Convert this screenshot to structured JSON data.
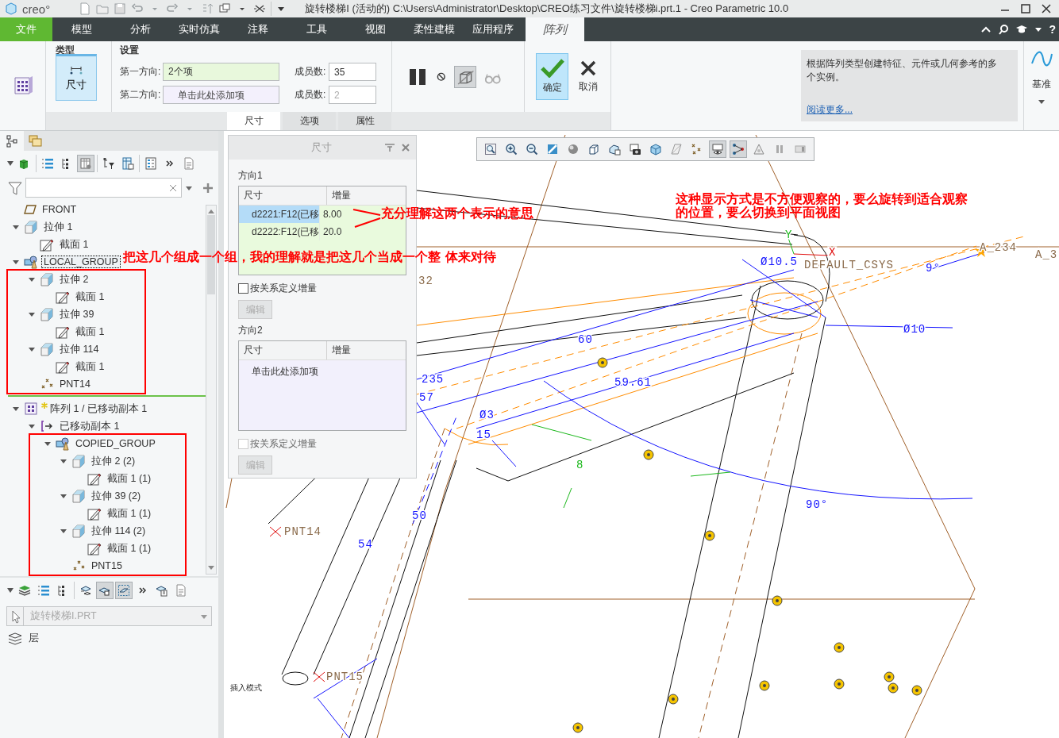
{
  "title_bar": {
    "logo": "creo°",
    "title": "旋转楼梯I (活动的) C:\\Users\\Administrator\\Desktop\\CREO练习文件\\旋转楼梯i.prt.1 - Creo Parametric 10.0"
  },
  "menu_tabs": [
    {
      "label": "文件",
      "kind": "file",
      "selected": false
    },
    {
      "label": "模型",
      "kind": "tab",
      "selected": false
    },
    {
      "label": "分析",
      "kind": "tab",
      "selected": false
    },
    {
      "label": "实时仿真",
      "kind": "tab",
      "selected": false
    },
    {
      "label": "注释",
      "kind": "tab",
      "selected": false
    },
    {
      "label": "工具",
      "kind": "tab",
      "selected": false
    },
    {
      "label": "视图",
      "kind": "tab",
      "selected": false
    },
    {
      "label": "柔性建模",
      "kind": "tab",
      "selected": false
    },
    {
      "label": "应用程序",
      "kind": "tab",
      "selected": false
    },
    {
      "label": "阵列",
      "kind": "tab",
      "selected": true
    }
  ],
  "menu_help": "?",
  "ribbon": {
    "type_group": {
      "title": "类型",
      "button": "尺寸"
    },
    "settings": {
      "title": "设置",
      "rows": [
        {
          "label": "第一方向:",
          "value": "2个项",
          "count_label": "成员数:",
          "count": "35",
          "count_disabled": false
        },
        {
          "label": "第二方向:",
          "placeholder": "单击此处添加项",
          "count_label": "成员数:",
          "count": "2",
          "count_disabled": true
        }
      ]
    },
    "tools": [
      {
        "kind": "pause",
        "pressed": false
      },
      {
        "kind": "prohibit",
        "pressed": false
      },
      {
        "kind": "preview",
        "pressed": true
      },
      {
        "kind": "glasses",
        "pressed": false
      }
    ],
    "confirm": "确定",
    "cancel": "取消",
    "info": {
      "text": "根据阵列类型创建特征、元件或几何参考的多个实例。",
      "link": "阅读更多..."
    },
    "datum": "基准",
    "sub_tabs": [
      {
        "label": "尺寸",
        "selected": true
      },
      {
        "label": "选项",
        "selected": false
      },
      {
        "label": "属性",
        "selected": false
      }
    ]
  },
  "model_tree": {
    "toolbar": [
      {
        "kind": "display",
        "pressed": false
      },
      {
        "kind": "list",
        "pressed": false
      },
      {
        "kind": "tree-list",
        "pressed": false
      },
      {
        "kind": "table-eye",
        "pressed": true
      },
      {
        "kind": "tree-filter",
        "pressed": false
      },
      {
        "kind": "table-settings",
        "pressed": false
      },
      {
        "kind": "columns",
        "pressed": false
      },
      {
        "kind": "more",
        "pressed": false
      },
      {
        "kind": "document",
        "pressed": false
      }
    ],
    "items": [
      {
        "label": "FRONT",
        "kind": "datum-plane",
        "selected": false,
        "marked": false
      },
      {
        "label": "拉伸 1",
        "kind": "extrude",
        "selected": false,
        "marked": false,
        "expanded": true,
        "children": [
          {
            "label": "截面 1",
            "kind": "sketch",
            "selected": false,
            "marked": false
          }
        ]
      },
      {
        "label": "LOCAL_GROUP",
        "kind": "group",
        "selected": true,
        "marked": false,
        "expanded": true,
        "children": [
          {
            "label": "拉伸 2",
            "kind": "extrude",
            "selected": false,
            "marked": true,
            "expanded": true,
            "children": [
              {
                "label": "截面 1",
                "kind": "sketch",
                "selected": false,
                "marked": false
              }
            ]
          },
          {
            "label": "拉伸 39",
            "kind": "extrude",
            "selected": false,
            "marked": true,
            "expanded": true,
            "children": [
              {
                "label": "截面 1",
                "kind": "sketch",
                "selected": false,
                "marked": false
              }
            ]
          },
          {
            "label": "拉伸 114",
            "kind": "extrude",
            "selected": false,
            "marked": true,
            "expanded": true,
            "children": [
              {
                "label": "截面 1",
                "kind": "sketch",
                "selected": false,
                "marked": false
              }
            ]
          },
          {
            "label": "PNT14",
            "kind": "point",
            "selected": false,
            "marked": true
          }
        ]
      },
      {
        "kind": "insert-marker"
      },
      {
        "label": "阵列 1 / 已移动副本 1",
        "kind": "pattern",
        "selected": false,
        "marked": false,
        "expanded": true,
        "children": [
          {
            "label": "已移动副本 1",
            "kind": "copy",
            "selected": false,
            "marked": false,
            "expanded": true,
            "children": [
              {
                "label": "COPIED_GROUP",
                "kind": "group",
                "selected": false,
                "marked": true,
                "expanded": true,
                "children": [
                  {
                    "label": "拉伸 2 (2)",
                    "kind": "extrude",
                    "selected": false,
                    "marked": false,
                    "expanded": true,
                    "children": [
                      {
                        "label": "截面 1 (1)",
                        "kind": "sketch",
                        "selected": false,
                        "marked": false
                      }
                    ]
                  },
                  {
                    "label": "拉伸 39 (2)",
                    "kind": "extrude",
                    "selected": false,
                    "marked": false,
                    "expanded": true,
                    "children": [
                      {
                        "label": "截面 1 (1)",
                        "kind": "sketch",
                        "selected": false,
                        "marked": false
                      }
                    ]
                  },
                  {
                    "label": "拉伸 114 (2)",
                    "kind": "extrude",
                    "selected": false,
                    "marked": false,
                    "expanded": true,
                    "children": [
                      {
                        "label": "截面 1 (1)",
                        "kind": "sketch",
                        "selected": false,
                        "marked": false
                      }
                    ]
                  },
                  {
                    "label": "PNT15",
                    "kind": "point",
                    "selected": false,
                    "marked": false
                  }
                ]
              }
            ]
          }
        ]
      }
    ]
  },
  "layers": {
    "toolbar": [
      {
        "kind": "layers",
        "pressed": false
      },
      {
        "kind": "list",
        "pressed": false
      },
      {
        "kind": "tree-list",
        "pressed": false
      },
      {
        "kind": "layer-eye",
        "pressed": false
      },
      {
        "kind": "layer-box",
        "pressed": true
      },
      {
        "kind": "layer-dashed",
        "pressed": true
      },
      {
        "kind": "more",
        "pressed": false
      },
      {
        "kind": "layer-settings",
        "pressed": false
      },
      {
        "kind": "document",
        "pressed": false
      }
    ],
    "model": {
      "value": "旋转楼梯I.PRT",
      "disabled": true
    },
    "items": [
      {
        "label": "层"
      }
    ]
  },
  "dim_panel": {
    "title": "尺寸",
    "sections": [
      {
        "label": "方向1",
        "columns": [
          "尺寸",
          "增量"
        ],
        "rows": [
          {
            "dimension": "d2221:F12(已移",
            "increment": "8.00",
            "selected": true
          },
          {
            "dimension": "d2222:F12(已移",
            "increment": "20.0",
            "selected": false
          }
        ],
        "checkbox": {
          "label": "按关系定义增量",
          "checked": false,
          "disabled": false
        },
        "edit_button": {
          "label": "编辑",
          "disabled": true
        }
      },
      {
        "label": "方向2",
        "columns": [
          "尺寸",
          "增量"
        ],
        "placeholder": "单击此处添加项",
        "checkbox": {
          "label": "按关系定义增量",
          "checked": false,
          "disabled": true
        },
        "edit_button": {
          "label": "编辑",
          "disabled": true
        }
      }
    ]
  },
  "view_toolbar": [
    {
      "kind": "zoom-fit",
      "pressed": false
    },
    {
      "kind": "zoom-in",
      "pressed": false
    },
    {
      "kind": "zoom-out",
      "pressed": false
    },
    {
      "kind": "repaint",
      "pressed": false
    },
    {
      "kind": "sphere",
      "pressed": false
    },
    {
      "kind": "cube",
      "pressed": false
    },
    {
      "kind": "saved-view",
      "pressed": false
    },
    {
      "kind": "camera",
      "pressed": false
    },
    {
      "kind": "shaded-cube",
      "pressed": false
    },
    {
      "kind": "plane",
      "pressed": false
    },
    {
      "kind": "points",
      "pressed": false
    },
    {
      "kind": "eye-layer",
      "pressed": true
    },
    {
      "kind": "node-graph",
      "pressed": true
    },
    {
      "kind": "triangle",
      "pressed": false
    },
    {
      "kind": "pause",
      "pressed": false
    },
    {
      "kind": "film",
      "pressed": false
    }
  ],
  "viewport": {
    "labels": [
      {
        "text": "32",
        "kind": "datum"
      },
      {
        "text": "Ø10.5",
        "kind": "dimension"
      },
      {
        "text": "DEFAULT_CSYS",
        "kind": "datum"
      },
      {
        "text": "A_234",
        "kind": "datum"
      },
      {
        "text": "A_3",
        "kind": "datum"
      },
      {
        "text": "9°",
        "kind": "dimension"
      },
      {
        "text": "Ø10",
        "kind": "dimension"
      },
      {
        "text": "60",
        "kind": "dimension"
      },
      {
        "text": "59.61",
        "kind": "dimension"
      },
      {
        "text": "235",
        "kind": "dimension"
      },
      {
        "text": "57",
        "kind": "dimension"
      },
      {
        "text": "Ø3",
        "kind": "dimension"
      },
      {
        "text": "15",
        "kind": "dimension"
      },
      {
        "text": "8",
        "kind": "reference"
      },
      {
        "text": "90°",
        "kind": "dimension"
      },
      {
        "text": "50",
        "kind": "dimension"
      },
      {
        "text": "54",
        "kind": "dimension"
      },
      {
        "text": "PNT14",
        "kind": "datum"
      },
      {
        "text": "PNT15",
        "kind": "datum"
      },
      {
        "text": "Y",
        "kind": "axis-y"
      },
      {
        "text": "X",
        "kind": "axis-x"
      }
    ],
    "status": "插入模式"
  },
  "annotations": [
    {
      "text": "把这几个组成一个组，我的理解就是把这几个当成一个整 体来对待"
    },
    {
      "text": "充分理解这两个表示的意思"
    },
    {
      "text": "这种显示方式是不方便观察的，要么旋转到适合观察的位置，要么切换到平面视图"
    }
  ]
}
